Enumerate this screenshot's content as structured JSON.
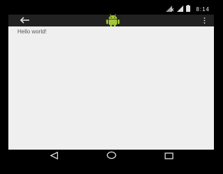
{
  "status_bar": {
    "time": "8:14",
    "icons": [
      "signal-off-icon",
      "signal-icon",
      "battery-icon"
    ]
  },
  "action_bar": {
    "back_icon": "back-arrow-icon",
    "logo_icon": "android-robot-icon",
    "overflow_icon": "overflow-menu-icon",
    "background": "#212121"
  },
  "content": {
    "text": "Hello world!",
    "background": "#efefef"
  },
  "nav_bar": {
    "buttons": [
      "back-triangle-icon",
      "home-circle-icon",
      "recents-square-icon"
    ]
  },
  "colors": {
    "android_green": "#a4c639",
    "icon_light": "#e0e0e0"
  }
}
